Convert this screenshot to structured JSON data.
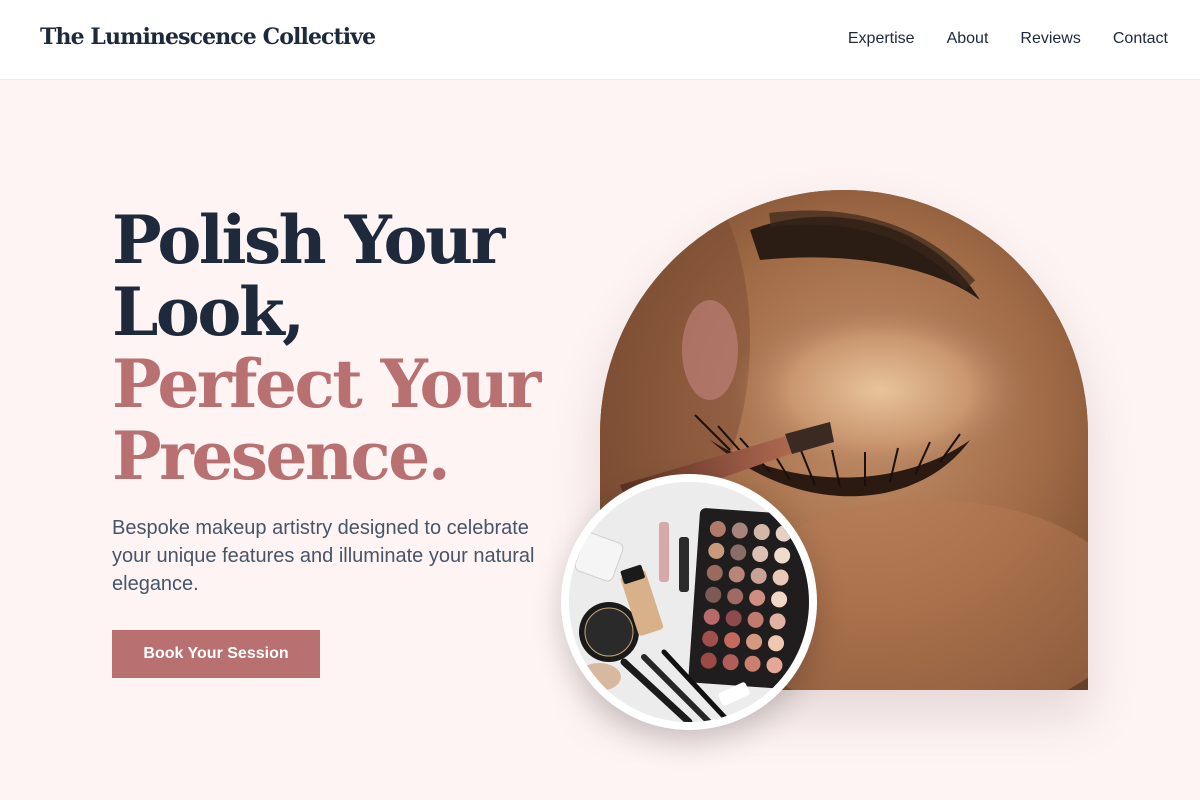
{
  "header": {
    "brand": "The Luminescence Collective",
    "nav": [
      "Expertise",
      "About",
      "Reviews",
      "Contact"
    ]
  },
  "hero": {
    "title_line1": "Polish Your Look,",
    "title_line2": "Perfect Your Presence.",
    "subtitle": "Bespoke makeup artistry designed to celebrate your unique features and illuminate your natural elegance.",
    "cta_label": "Book Your Session"
  },
  "images": {
    "arch": "eye-makeup-closeup",
    "inset": "makeup-palette-flatlay"
  },
  "colors": {
    "background": "#fdf4f3",
    "navy": "#1e293b",
    "rose": "#b87070",
    "muted": "#475569"
  }
}
